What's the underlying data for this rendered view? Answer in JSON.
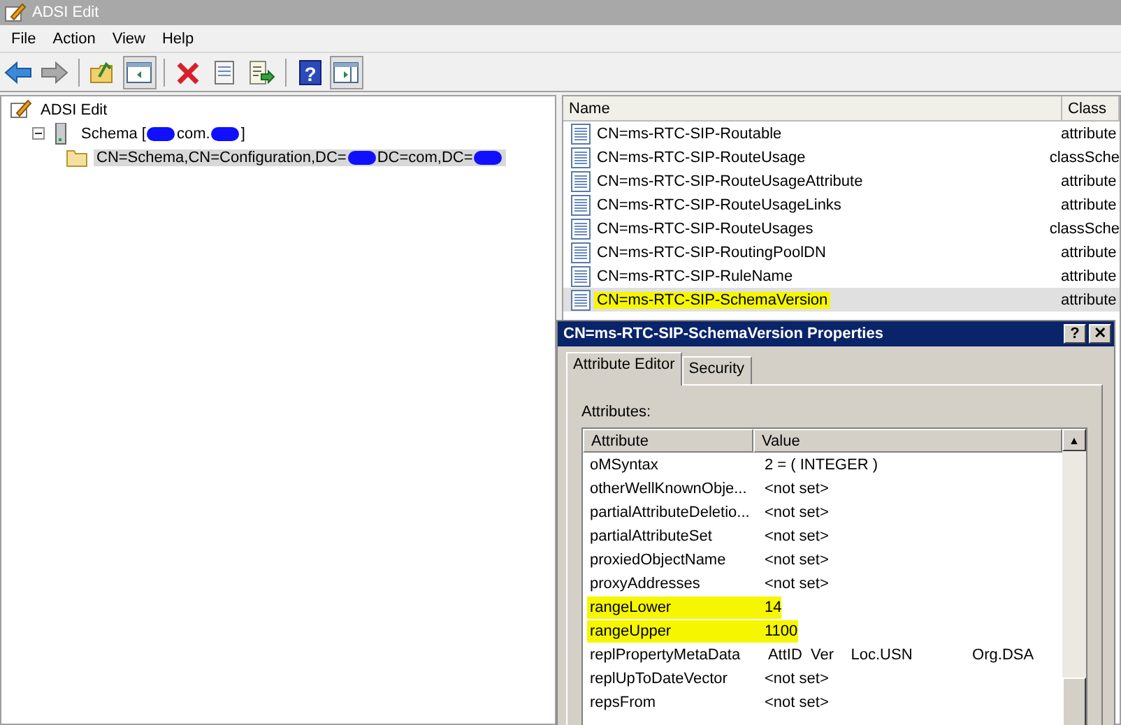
{
  "window": {
    "title": "ADSI Edit"
  },
  "menu": [
    "File",
    "Action",
    "View",
    "Help"
  ],
  "toolbar": [
    {
      "kind": "back",
      "pressed": false
    },
    {
      "kind": "forward",
      "pressed": false
    },
    {
      "kind": "sep"
    },
    {
      "kind": "up",
      "pressed": false
    },
    {
      "kind": "tree",
      "pressed": true
    },
    {
      "kind": "sep"
    },
    {
      "kind": "delete",
      "pressed": false
    },
    {
      "kind": "properties",
      "pressed": false
    },
    {
      "kind": "export",
      "pressed": false
    },
    {
      "kind": "sep"
    },
    {
      "kind": "help",
      "label": "?",
      "pressed": false
    },
    {
      "kind": "pane",
      "pressed": true
    }
  ],
  "tree": [
    {
      "label": "ADSI Edit",
      "kind": "edit",
      "selected": false,
      "children": [
        {
          "parts": [
            {
              "kind": "text",
              "text": "Schema ["
            },
            {
              "kind": "redacted"
            },
            {
              "kind": "text",
              "text": "com."
            },
            {
              "kind": "redacted"
            },
            {
              "kind": "text",
              "text": "]"
            }
          ],
          "kind": "server",
          "expanded": true,
          "selected": false,
          "children": [
            {
              "parts": [
                {
                  "kind": "text",
                  "text": "CN=Schema,CN=Configuration,DC="
                },
                {
                  "kind": "redacted"
                },
                {
                  "kind": "text",
                  "text": "DC=com,DC="
                },
                {
                  "kind": "redacted"
                }
              ],
              "kind": "folder",
              "selected": true
            }
          ]
        }
      ]
    }
  ],
  "list": {
    "columns": [
      "Name",
      "Class"
    ],
    "rows": [
      {
        "name": "CN=ms-RTC-SIP-Routable",
        "class": "attribute",
        "selected": false,
        "highlighted": false
      },
      {
        "name": "CN=ms-RTC-SIP-RouteUsage",
        "class": "classSche",
        "selected": false,
        "highlighted": false
      },
      {
        "name": "CN=ms-RTC-SIP-RouteUsageAttribute",
        "class": "attribute",
        "selected": false,
        "highlighted": false
      },
      {
        "name": "CN=ms-RTC-SIP-RouteUsageLinks",
        "class": "attribute",
        "selected": false,
        "highlighted": false
      },
      {
        "name": "CN=ms-RTC-SIP-RouteUsages",
        "class": "classSche",
        "selected": false,
        "highlighted": false
      },
      {
        "name": "CN=ms-RTC-SIP-RoutingPoolDN",
        "class": "attribute",
        "selected": false,
        "highlighted": false
      },
      {
        "name": "CN=ms-RTC-SIP-RuleName",
        "class": "attribute",
        "selected": false,
        "highlighted": false
      },
      {
        "name": "CN=ms-RTC-SIP-SchemaVersion",
        "class": "attribute",
        "selected": true,
        "highlighted": true
      }
    ]
  },
  "dialog": {
    "title": "CN=ms-RTC-SIP-SchemaVersion Properties",
    "help_button": "?",
    "close_button": "✕",
    "tabs": [
      {
        "label": "Attribute Editor",
        "selected": true
      },
      {
        "label": "Security",
        "selected": false
      }
    ],
    "attributes_label": "Attributes:",
    "columns": [
      "Attribute",
      "Value"
    ],
    "rows": [
      {
        "attribute": "oMSyntax",
        "value": "2 = ( INTEGER )",
        "highlighted": false
      },
      {
        "attribute": "otherWellKnownObje...",
        "value": "<not set>",
        "highlighted": false
      },
      {
        "attribute": "partialAttributeDeletio...",
        "value": "<not set>",
        "highlighted": false
      },
      {
        "attribute": "partialAttributeSet",
        "value": "<not set>",
        "highlighted": false
      },
      {
        "attribute": "proxiedObjectName",
        "value": "<not set>",
        "highlighted": false
      },
      {
        "attribute": "proxyAddresses",
        "value": "<not set>",
        "highlighted": false
      },
      {
        "attribute": "rangeLower",
        "value": "14",
        "highlighted": true
      },
      {
        "attribute": "rangeUpper",
        "value": "1100",
        "highlighted": true
      },
      {
        "attribute": "replPropertyMetaData",
        "value": " AttID  Ver    Loc.USN              Org.DSA",
        "highlighted": false
      },
      {
        "attribute": "replUpToDateVector",
        "value": "<not set>",
        "highlighted": false
      },
      {
        "attribute": "repsFrom",
        "value": "<not set>",
        "highlighted": false
      }
    ],
    "scroll_up": "▲"
  }
}
